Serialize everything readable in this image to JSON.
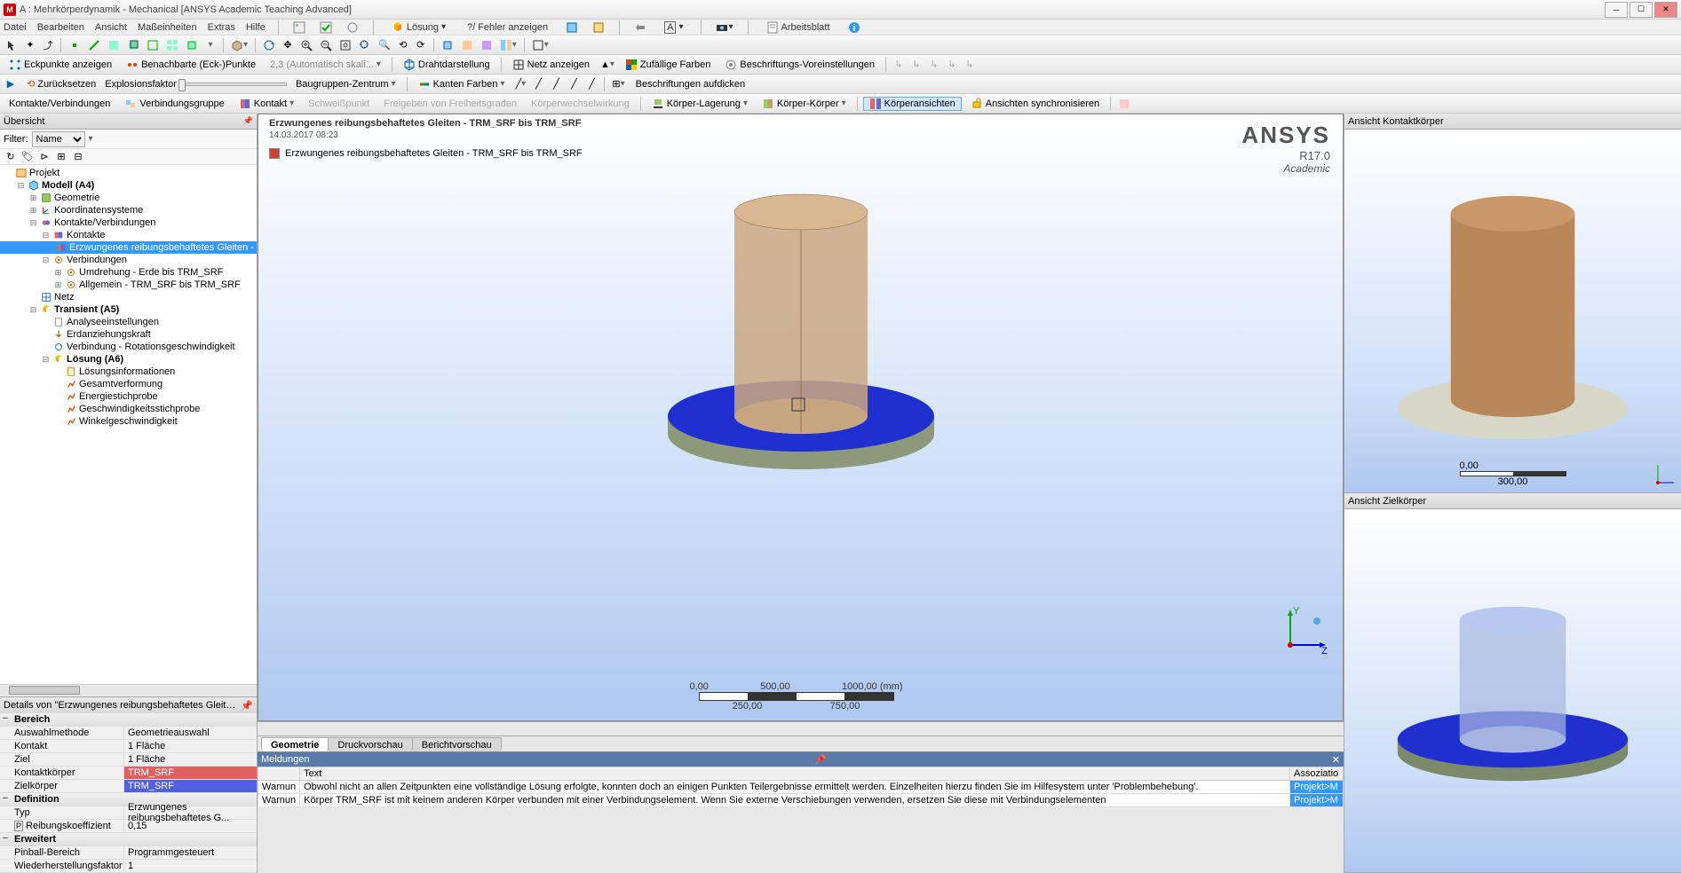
{
  "title": "A : Mehrkörperdynamik - Mechanical [ANSYS Academic Teaching Advanced]",
  "menu": [
    "Datei",
    "Bearbeiten",
    "Ansicht",
    "Maßeinheiten",
    "Extras",
    "Hilfe"
  ],
  "tb2": {
    "solve": "Lösung",
    "errors": "?/ Fehler anzeigen",
    "worksheet": "Arbeitsblatt"
  },
  "tb4": {
    "eckpunkte": "Eckpunkte anzeigen",
    "benachbarte": "Benachbarte (Eck-)Punkte",
    "autoscale": "2,3 (Automatisch skali...",
    "draht": "Drahtdarstellung",
    "netz": "Netz anzeigen",
    "farben": "Zufällige Farben",
    "beschrift": "Beschriftungs-Voreinstellungen"
  },
  "tb5": {
    "reset": "Zurücksetzen",
    "explosion": "Explosionsfaktor",
    "center": "Baugruppen-Zentrum",
    "kantenfarben": "Kanten Farben",
    "dicken": "Beschriftungen aufdicken"
  },
  "tb6": {
    "kontakte": "Kontakte/Verbindungen",
    "vgruppe": "Verbindungsgruppe",
    "kontakt": "Kontakt",
    "schweiss": "Schweißpunkt",
    "freigeben": "Freigeben von Freiheitsgraden",
    "wechsel": "Körperwechselwirkung",
    "klagerung": "Körper-Lagerung",
    "kkorper": "Körper-Körper",
    "ansichten": "Körperansichten",
    "sync": "Ansichten synchronisieren"
  },
  "overview": {
    "title": "Übersicht",
    "filter_label": "Filter:",
    "filter_value": "Name"
  },
  "tree": [
    {
      "d": 0,
      "exp": "",
      "ico": "proj",
      "lbl": "Projekt",
      "bold": false
    },
    {
      "d": 1,
      "exp": "−",
      "ico": "model",
      "lbl": "Modell (A4)",
      "bold": true
    },
    {
      "d": 2,
      "exp": "+",
      "ico": "geom",
      "lbl": "Geometrie",
      "bold": false
    },
    {
      "d": 2,
      "exp": "+",
      "ico": "coord",
      "lbl": "Koordinatensysteme",
      "bold": false
    },
    {
      "d": 2,
      "exp": "−",
      "ico": "conn",
      "lbl": "Kontakte/Verbindungen",
      "bold": false
    },
    {
      "d": 3,
      "exp": "−",
      "ico": "contacts",
      "lbl": "Kontakte",
      "bold": false
    },
    {
      "d": 4,
      "exp": "",
      "ico": "contact",
      "lbl": "Erzwungenes reibungsbehaftetes Gleiten - T",
      "bold": false,
      "sel": true
    },
    {
      "d": 3,
      "exp": "−",
      "ico": "joints",
      "lbl": "Verbindungen",
      "bold": false
    },
    {
      "d": 4,
      "exp": "+",
      "ico": "joint",
      "lbl": "Umdrehung - Erde bis  TRM_SRF",
      "bold": false
    },
    {
      "d": 4,
      "exp": "+",
      "ico": "joint",
      "lbl": "Allgemein -  TRM_SRF bis  TRM_SRF",
      "bold": false
    },
    {
      "d": 2,
      "exp": "",
      "ico": "mesh",
      "lbl": "Netz",
      "bold": false
    },
    {
      "d": 2,
      "exp": "−",
      "ico": "trans",
      "lbl": "Transient (A5)",
      "bold": true
    },
    {
      "d": 3,
      "exp": "",
      "ico": "set",
      "lbl": "Analyseeinstellungen",
      "bold": false
    },
    {
      "d": 3,
      "exp": "",
      "ico": "grav",
      "lbl": "Erdanziehungskraft",
      "bold": false
    },
    {
      "d": 3,
      "exp": "",
      "ico": "rot",
      "lbl": "Verbindung - Rotationsgeschwindigkeit",
      "bold": false
    },
    {
      "d": 3,
      "exp": "−",
      "ico": "sol",
      "lbl": "Lösung (A6)",
      "bold": true
    },
    {
      "d": 4,
      "exp": "",
      "ico": "info",
      "lbl": "Lösungsinformationen",
      "bold": false
    },
    {
      "d": 4,
      "exp": "",
      "ico": "res",
      "lbl": "Gesamtverformung",
      "bold": false
    },
    {
      "d": 4,
      "exp": "",
      "ico": "res",
      "lbl": "Energiestichprobe",
      "bold": false
    },
    {
      "d": 4,
      "exp": "",
      "ico": "res",
      "lbl": "Geschwindigkeitsstichprobe",
      "bold": false
    },
    {
      "d": 4,
      "exp": "",
      "ico": "res",
      "lbl": "Winkelgeschwindigkeit",
      "bold": false
    }
  ],
  "details": {
    "title": "Details von \"Erzwungenes reibungsbehaftetes Gleiten -  TRM_...",
    "sections": [
      {
        "section": "Bereich"
      },
      {
        "k": "Auswahlmethode",
        "v": "Geometrieauswahl"
      },
      {
        "k": "Kontakt",
        "v": "1 Fläche"
      },
      {
        "k": "Ziel",
        "v": "1 Fläche"
      },
      {
        "k": "Kontaktkörper",
        "v": "TRM_SRF",
        "cls": "red"
      },
      {
        "k": "Zielkörper",
        "v": "TRM_SRF",
        "cls": "blue"
      },
      {
        "section": "Definition"
      },
      {
        "k": "Typ",
        "v": "Erzwungenes reibungsbehaftetes G..."
      },
      {
        "k": "Reibungskoeffizient",
        "v": "0,15",
        "box": true
      },
      {
        "section": "Erweitert"
      },
      {
        "k": "Pinball-Bereich",
        "v": "Programmgesteuert"
      },
      {
        "k": "Wiederherstellungsfaktor",
        "v": "1"
      }
    ]
  },
  "viewport": {
    "title": "Erzwungenes reibungsbehaftetes Gleiten -  TRM_SRF bis  TRM_SRF",
    "date": "14.03.2017 08:23",
    "legend": "Erzwungenes reibungsbehaftetes Gleiten -  TRM_SRF bis  TRM_SRF",
    "brand": "ANSYS",
    "ver": "R17.0",
    "ed": "Academic",
    "scale": {
      "vals": [
        "0,00",
        "500,00",
        "1000,00 (mm)"
      ],
      "mids": [
        "250,00",
        "750,00"
      ]
    }
  },
  "tabs": [
    "Geometrie",
    "Druckvorschau",
    "Berichtvorschau"
  ],
  "messages": {
    "title": "Meldungen",
    "cols": [
      "",
      "Text",
      "Assoziatio"
    ],
    "rows": [
      {
        "lvl": "Warnun",
        "txt": "Obwohl nicht an allen Zeitpunkten eine vollständige Lösung erfolgte, konnten doch an einigen Punkten Teilergebnisse ermittelt werden.  Einzelheiten hierzu finden Sie im Hilfesystem unter 'Problembehebung'.",
        "assoc": "Projekt>M"
      },
      {
        "lvl": "Warnun",
        "txt": "Körper  TRM_SRF ist mit keinem anderen Körper verbunden mit einer Verbindungselement. Wenn Sie externe Verschiebungen verwenden, ersetzen Sie diese mit Verbindungselementen",
        "assoc": "Projekt>M"
      }
    ]
  },
  "right": {
    "kontakt": "Ansicht Kontaktkörper",
    "ziel": "Ansicht Zielkörper",
    "scale": "300,00"
  }
}
